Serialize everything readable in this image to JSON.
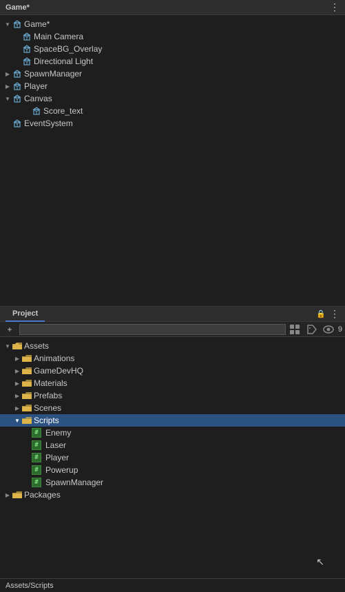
{
  "hierarchy": {
    "panel_title": "Game*",
    "tree_items": [
      {
        "id": "main-camera",
        "label": "Main Camera",
        "indent": 1,
        "has_arrow": false,
        "arrow_state": "empty",
        "icon": "cube"
      },
      {
        "id": "spacebg-overlay",
        "label": "SpaceBG_Overlay",
        "indent": 1,
        "has_arrow": false,
        "arrow_state": "empty",
        "icon": "cube"
      },
      {
        "id": "directional-light",
        "label": "Directional Light",
        "indent": 1,
        "has_arrow": false,
        "arrow_state": "empty",
        "icon": "cube"
      },
      {
        "id": "spawn-manager",
        "label": "SpawnManager",
        "indent": 0,
        "has_arrow": true,
        "arrow_state": "collapsed",
        "icon": "cube"
      },
      {
        "id": "player",
        "label": "Player",
        "indent": 0,
        "has_arrow": true,
        "arrow_state": "collapsed",
        "icon": "cube"
      },
      {
        "id": "canvas",
        "label": "Canvas",
        "indent": 0,
        "has_arrow": true,
        "arrow_state": "expanded",
        "icon": "cube"
      },
      {
        "id": "score-text",
        "label": "Score_text",
        "indent": 2,
        "has_arrow": false,
        "arrow_state": "empty",
        "icon": "cube"
      },
      {
        "id": "event-system",
        "label": "EventSystem",
        "indent": 0,
        "has_arrow": false,
        "arrow_state": "empty",
        "icon": "cube"
      }
    ]
  },
  "project": {
    "panel_title": "Project",
    "search_placeholder": "",
    "eye_count": "9",
    "tree_items": [
      {
        "id": "assets",
        "label": "Assets",
        "indent": 0,
        "arrow_state": "expanded",
        "icon": "folder",
        "selected": false
      },
      {
        "id": "animations",
        "label": "Animations",
        "indent": 1,
        "arrow_state": "collapsed",
        "icon": "folder",
        "selected": false
      },
      {
        "id": "gamedevhq",
        "label": "GameDevHQ",
        "indent": 1,
        "arrow_state": "collapsed",
        "icon": "folder",
        "selected": false
      },
      {
        "id": "materials",
        "label": "Materials",
        "indent": 1,
        "arrow_state": "collapsed",
        "icon": "folder",
        "selected": false
      },
      {
        "id": "prefabs",
        "label": "Prefabs",
        "indent": 1,
        "arrow_state": "collapsed",
        "icon": "folder",
        "selected": false
      },
      {
        "id": "scenes",
        "label": "Scenes",
        "indent": 1,
        "arrow_state": "collapsed",
        "icon": "folder",
        "selected": false
      },
      {
        "id": "scripts",
        "label": "Scripts",
        "indent": 1,
        "arrow_state": "expanded",
        "icon": "folder",
        "selected": true
      },
      {
        "id": "enemy",
        "label": "Enemy",
        "indent": 2,
        "arrow_state": "none",
        "icon": "script",
        "selected": false
      },
      {
        "id": "laser",
        "label": "Laser",
        "indent": 2,
        "arrow_state": "none",
        "icon": "script",
        "selected": false
      },
      {
        "id": "player-script",
        "label": "Player",
        "indent": 2,
        "arrow_state": "none",
        "icon": "script",
        "selected": false
      },
      {
        "id": "powerup",
        "label": "Powerup",
        "indent": 2,
        "arrow_state": "none",
        "icon": "script",
        "selected": false
      },
      {
        "id": "spawn-manager-script",
        "label": "SpawnManager",
        "indent": 2,
        "arrow_state": "none",
        "icon": "script",
        "selected": false
      },
      {
        "id": "packages",
        "label": "Packages",
        "indent": 0,
        "arrow_state": "collapsed",
        "icon": "folder",
        "selected": false
      }
    ],
    "status_text": "Assets/Scripts"
  },
  "icons": {
    "three_dots": "⋮",
    "plus": "+",
    "search": "🔍",
    "lock": "🔒",
    "eye": "👁"
  }
}
